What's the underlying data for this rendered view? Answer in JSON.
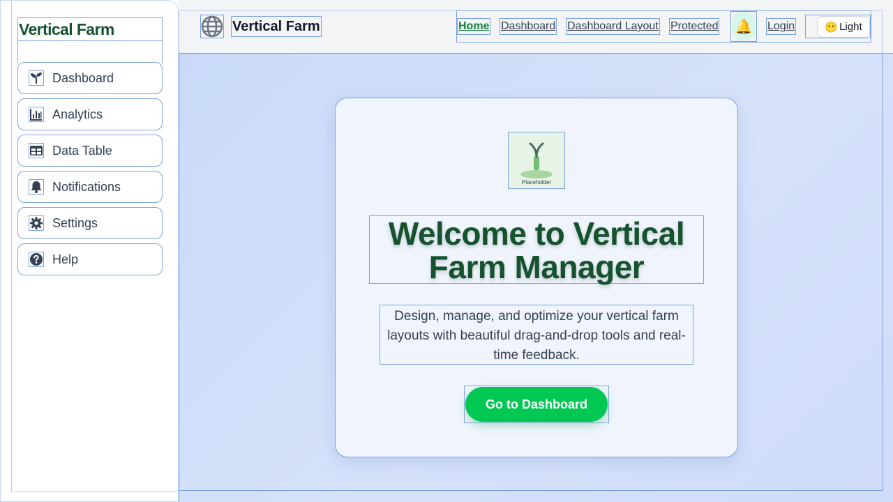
{
  "sidebar": {
    "brand": "Vertical Farm",
    "items": [
      {
        "label": "Dashboard",
        "icon": "sprout-icon"
      },
      {
        "label": "Analytics",
        "icon": "bar-chart-icon"
      },
      {
        "label": "Data Table",
        "icon": "table-icon"
      },
      {
        "label": "Notifications",
        "icon": "bell-icon"
      },
      {
        "label": "Settings",
        "icon": "gear-icon"
      },
      {
        "label": "Help",
        "icon": "question-icon"
      }
    ]
  },
  "header": {
    "title": "Vertical Farm",
    "logo_icon": "globe-icon",
    "nav": [
      {
        "label": "Home",
        "active": true
      },
      {
        "label": "Dashboard",
        "active": false
      },
      {
        "label": "Dashboard Layout",
        "active": false
      },
      {
        "label": "Protected",
        "active": false
      },
      {
        "label": "Login",
        "active": false
      }
    ],
    "notification_icon": "bell-icon",
    "theme_toggle": {
      "emoji": "😶",
      "label": "Light"
    }
  },
  "hero": {
    "image_label": "Placeholder",
    "title": "Welcome to Vertical Farm Manager",
    "subtitle": "Design, manage, and optimize your vertical farm layouts with beautiful drag-and-drop tools and real-time feedback.",
    "cta_label": "Go to Dashboard"
  },
  "colors": {
    "brand_green": "#14532d",
    "accent_green": "#00c853",
    "active_link": "#15803d",
    "icon_slate": "#334155",
    "main_bg": "#cfdcfa"
  }
}
